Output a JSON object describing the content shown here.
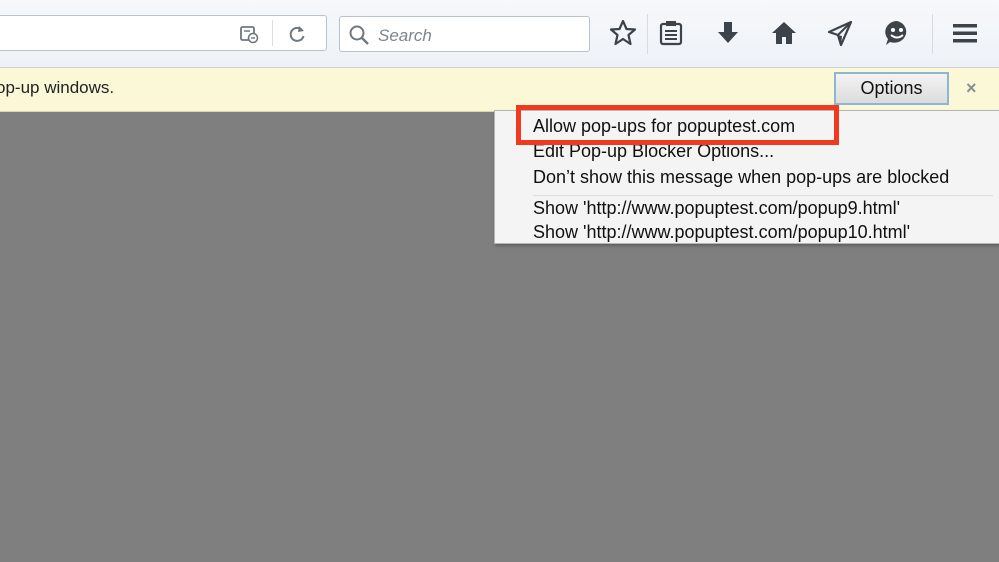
{
  "toolbar": {
    "search_placeholder": "Search",
    "icons": [
      "page-info-icon",
      "reload-icon",
      "search-icon",
      "bookmark-star-icon",
      "reading-list-icon",
      "downloads-icon",
      "home-icon",
      "share-icon",
      "hello-icon",
      "menu-icon"
    ]
  },
  "notification": {
    "message": "op-up windows.",
    "options_label": "Options",
    "close_label": "×"
  },
  "popup_menu": {
    "items": [
      "Allow pop-ups for popuptest.com",
      "Edit Pop-up Blocker Options...",
      "Don’t show this message when pop-ups are blocked",
      "Show 'http://www.popuptest.com/popup9.html'",
      "Show 'http://www.popuptest.com/popup10.html'"
    ]
  },
  "colors": {
    "highlight": "#f03a1f",
    "page_background": "#7f7f7f",
    "notification_background": "#fbf8d8"
  }
}
